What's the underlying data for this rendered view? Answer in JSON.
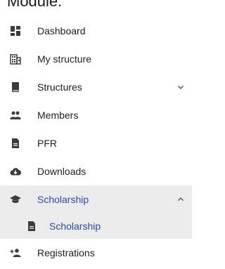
{
  "header": {
    "title": "Module:"
  },
  "nav": {
    "items": [
      {
        "label": "Dashboard",
        "icon": "dashboard-icon"
      },
      {
        "label": "My structure",
        "icon": "building-icon"
      },
      {
        "label": "Structures",
        "icon": "book-icon",
        "expandable": true,
        "expanded": false
      },
      {
        "label": "Members",
        "icon": "people-icon"
      },
      {
        "label": "PFR",
        "icon": "document-icon"
      },
      {
        "label": "Downloads",
        "icon": "cloud-download-icon"
      },
      {
        "label": "Scholarship",
        "icon": "graduation-cap-icon",
        "expandable": true,
        "expanded": true,
        "active": true
      },
      {
        "label": "Registrations",
        "icon": "person-add-icon"
      }
    ],
    "subitems": [
      {
        "label": "Scholarship",
        "icon": "document-icon",
        "active": true
      }
    ]
  },
  "colors": {
    "accent": "#2f4aa8",
    "icon": "#3c3c3c",
    "active_bg": "#ebebeb"
  }
}
